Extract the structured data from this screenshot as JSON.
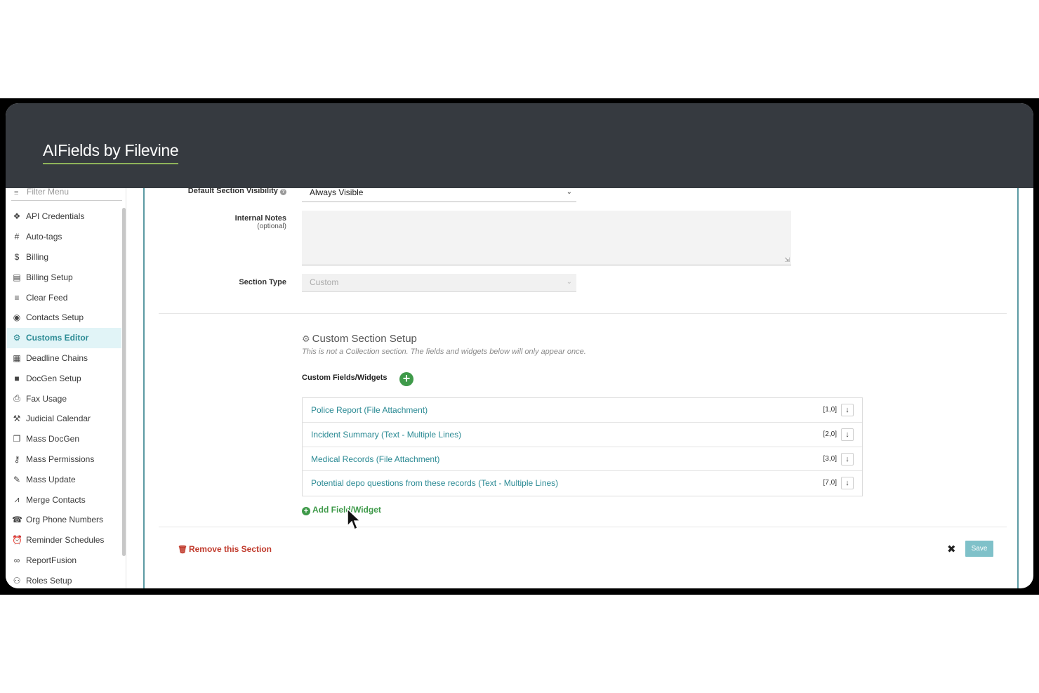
{
  "app": {
    "brand": "AIFields by Filevine"
  },
  "sidebar": {
    "filter_placeholder": "Filter Menu",
    "items": [
      {
        "label": "API Credentials",
        "icon": "api-icon"
      },
      {
        "label": "Auto-tags",
        "icon": "hash-icon"
      },
      {
        "label": "Billing",
        "icon": "dollar-icon"
      },
      {
        "label": "Billing Setup",
        "icon": "receipt-icon"
      },
      {
        "label": "Clear Feed",
        "icon": "clear-icon"
      },
      {
        "label": "Contacts Setup",
        "icon": "person-icon"
      },
      {
        "label": "Customs Editor",
        "icon": "gear-icon",
        "active": true
      },
      {
        "label": "Deadline Chains",
        "icon": "calendar-icon"
      },
      {
        "label": "DocGen Setup",
        "icon": "document-icon"
      },
      {
        "label": "Fax Usage",
        "icon": "fax-icon"
      },
      {
        "label": "Judicial Calendar",
        "icon": "gavel-icon"
      },
      {
        "label": "Mass DocGen",
        "icon": "documents-icon"
      },
      {
        "label": "Mass Permissions",
        "icon": "key-icon"
      },
      {
        "label": "Mass Update",
        "icon": "edit-list-icon"
      },
      {
        "label": "Merge Contacts",
        "icon": "merge-icon"
      },
      {
        "label": "Org Phone Numbers",
        "icon": "phone-icon"
      },
      {
        "label": "Reminder Schedules",
        "icon": "alarm-icon"
      },
      {
        "label": "ReportFusion",
        "icon": "fusion-icon"
      },
      {
        "label": "Roles Setup",
        "icon": "roles-icon"
      }
    ]
  },
  "form": {
    "visibility_label": "Default Section Visibility",
    "visibility_value": "Always Visible",
    "notes_label": "Internal Notes",
    "notes_sub": "(optional)",
    "type_label": "Section Type",
    "type_value": "Custom"
  },
  "setup": {
    "title": "Custom Section Setup",
    "description": "This is not a Collection section. The fields and widgets below will only appear once.",
    "fields_label": "Custom Fields/Widgets",
    "fields": [
      {
        "name": "Police Report (File Attachment)",
        "pos": "[1,0]"
      },
      {
        "name": "Incident Summary (Text - Multiple Lines)",
        "pos": "[2,0]"
      },
      {
        "name": "Medical Records (File Attachment)",
        "pos": "[3,0]"
      },
      {
        "name": "Potential depo questions from these records (Text - Multiple Lines)",
        "pos": "[7,0]"
      }
    ],
    "add_widget": "Add Field/Widget"
  },
  "footer": {
    "remove": "Remove this Section",
    "save": "Save"
  },
  "colors": {
    "accent": "#2b8a94",
    "green": "#3f9a4a",
    "danger": "#c0392b",
    "header": "#363a40"
  }
}
